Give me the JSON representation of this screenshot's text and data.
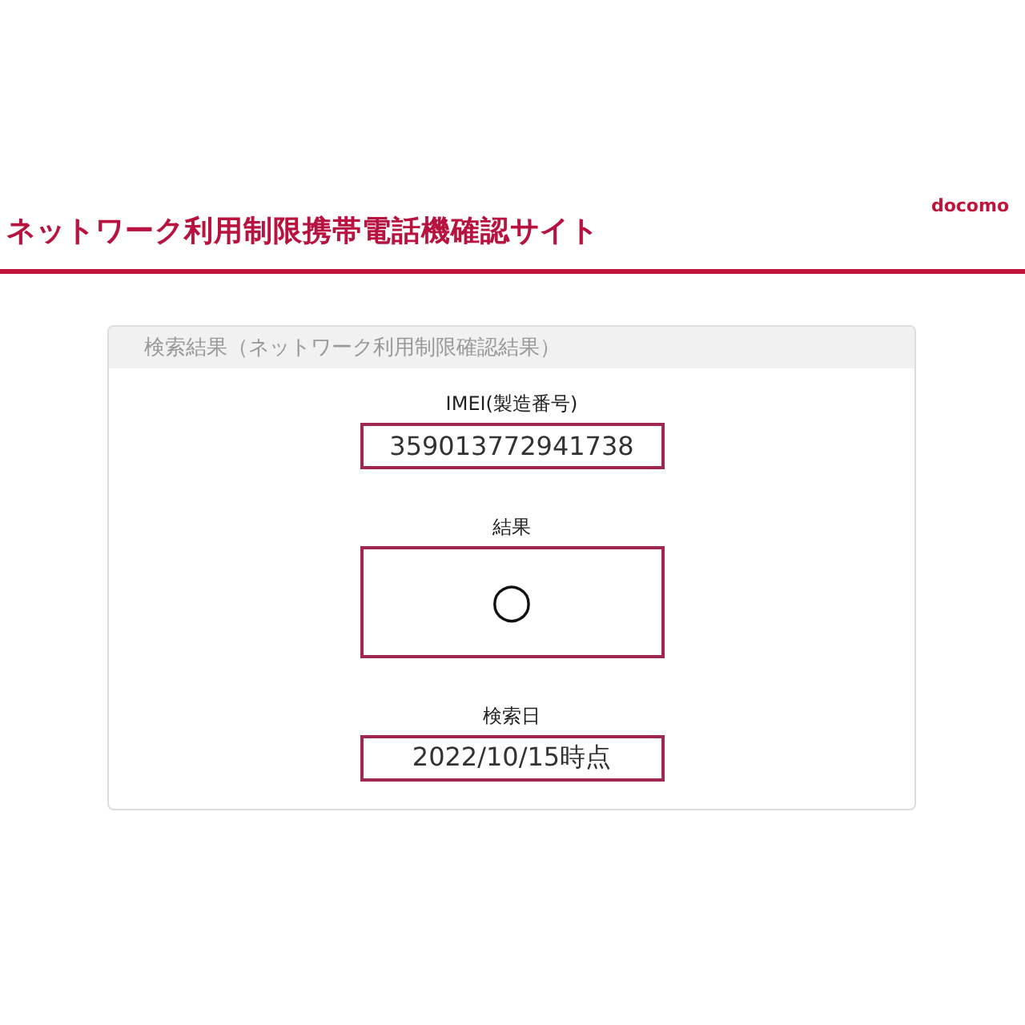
{
  "header": {
    "title": "ネットワーク利用制限携帯電話機確認サイト",
    "logo": "docomo"
  },
  "panel": {
    "title": "検索結果（ネットワーク利用制限確認結果）",
    "fields": [
      {
        "label": "IMEI(製造番号)",
        "value": "359013772941738",
        "kind": "text"
      },
      {
        "label": "結果",
        "value": "○",
        "kind": "mark"
      },
      {
        "label": "検索日",
        "value": "2022/10/15時点",
        "kind": "text"
      }
    ]
  }
}
